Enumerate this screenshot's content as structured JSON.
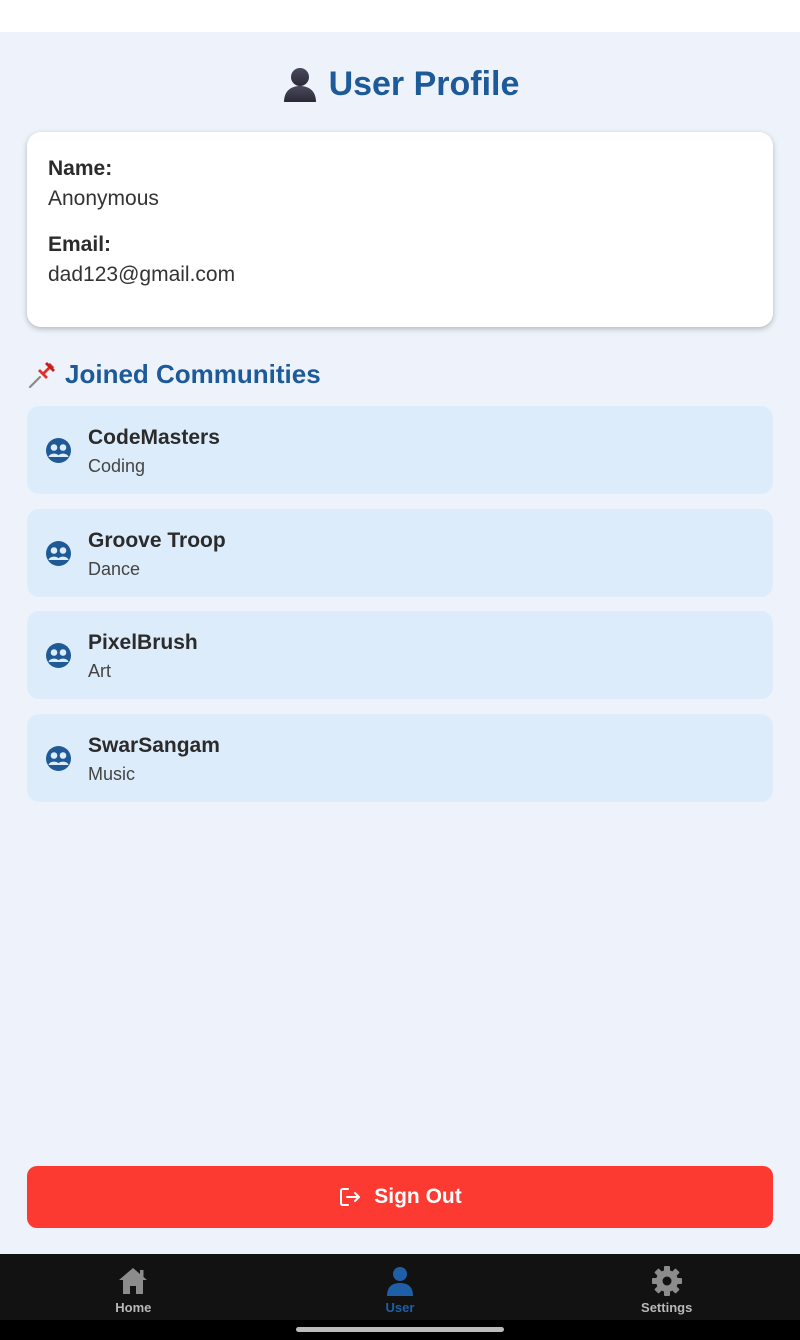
{
  "header": {
    "title": "User Profile",
    "title_icon": "user-silhouette-icon"
  },
  "profile": {
    "name_label": "Name:",
    "name_value": "Anonymous",
    "email_label": "Email:",
    "email_value": "dad123@gmail.com"
  },
  "communities_section": {
    "title": "Joined Communities",
    "title_icon": "pushpin-icon",
    "items": [
      {
        "name": "CodeMasters",
        "category": "Coding",
        "icon": "group-icon"
      },
      {
        "name": "Groove Troop",
        "category": "Dance",
        "icon": "group-icon"
      },
      {
        "name": "PixelBrush",
        "category": "Art",
        "icon": "group-icon"
      },
      {
        "name": "SwarSangam",
        "category": "Music",
        "icon": "group-icon"
      }
    ]
  },
  "signout": {
    "label": "Sign Out",
    "icon": "sign-out-icon"
  },
  "bottom_nav": {
    "items": [
      {
        "label": "Home",
        "icon": "home-icon",
        "active": false
      },
      {
        "label": "User",
        "icon": "user-icon",
        "active": true
      },
      {
        "label": "Settings",
        "icon": "gear-icon",
        "active": false
      }
    ]
  },
  "colors": {
    "accent": "#1d5a9a",
    "background": "#eef3fb",
    "community_item_bg": "#ddecfa",
    "danger": "#fc3a32",
    "nav_bg": "#121212",
    "nav_active": "#1f5fa8",
    "nav_inactive": "#b8b8b8"
  }
}
